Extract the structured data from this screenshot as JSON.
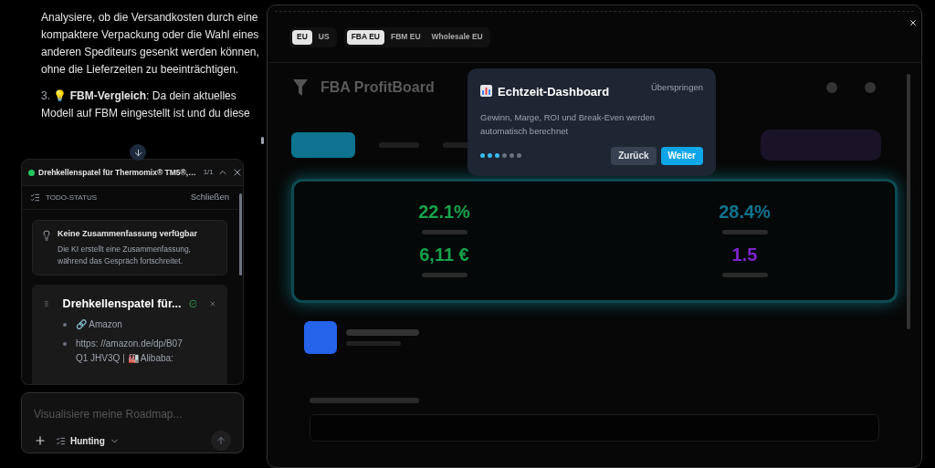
{
  "chat": {
    "paragraphs": [
      {
        "text": "Analysiere, ob die Versandkosten durch eine kompaktere Verpackung oder die Wahl eines anderen Spediteurs gesenkt werden können, ohne die Lieferzeiten zu beeinträchtigen."
      },
      {
        "number": "3.",
        "emoji": "💡",
        "text": "**FBM-Vergleich**: Da dein aktuelles Modell auf FBM eingestellt ist und du diese"
      }
    ]
  },
  "task_bar": {
    "title": "Drehkellenspatel für Thermomix® TM5®,…",
    "counter": "1/1"
  },
  "todo": {
    "heading": "TODO-STATUS",
    "close": "Schließen",
    "summary": {
      "title": "Keine Zusammenfassung verfügbar",
      "text": "Die KI erstellt eine Zusammenfassung, während das Gespräch fortschreitet."
    },
    "task": {
      "title": "Drehkellenspatel für...",
      "done": true,
      "bullets": [
        "🔗 Amazon",
        "https: //amazon.de/dp/B07Q1 JHV3Q | 🏭 Alibaba:"
      ]
    }
  },
  "composer": {
    "placeholder": "Visualisiere meine Roadmap...",
    "mode": "Hunting"
  },
  "region_toggle": [
    {
      "label": "EU",
      "selected": true
    },
    {
      "label": "US",
      "selected": false
    }
  ],
  "model_toggle": [
    {
      "label": "FBA EU",
      "selected": true
    },
    {
      "label": "FBM EU",
      "selected": false
    },
    {
      "label": "Wholesale EU",
      "selected": false
    }
  ],
  "dashboard": {
    "title": "FBA ProfitBoard",
    "metrics": [
      {
        "value": "22.1%",
        "color": "#16a34a"
      },
      {
        "value": "28.4%",
        "color": "#0e7490"
      },
      {
        "value": "6,11 €",
        "color": "#16a34a"
      },
      {
        "value": "1.5",
        "color": "#7e22ce"
      }
    ]
  },
  "tour": {
    "title": "Echtzeit-Dashboard",
    "skip": "Überspringen",
    "text": "Gewinn, Marge, ROI und Break-Even werden automatisch berechnet",
    "steps": [
      {
        "done": true
      },
      {
        "done": true
      },
      {
        "done": true
      },
      {
        "done": false
      },
      {
        "done": false
      },
      {
        "done": false
      }
    ],
    "back": "Zurück",
    "next": "Weiter"
  }
}
